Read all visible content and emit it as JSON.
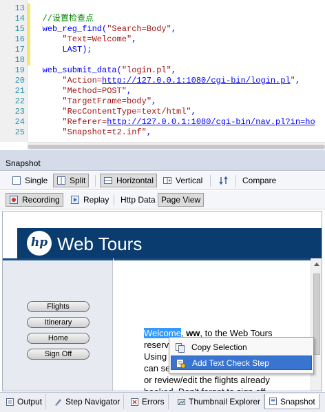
{
  "editor": {
    "lines": [
      {
        "num": "13",
        "text": ""
      },
      {
        "num": "14",
        "text": "        //设置检查点"
      },
      {
        "num": "15",
        "text": "        web_reg_find(\"Search=Body\","
      },
      {
        "num": "16",
        "text": "            \"Text=Welcome\","
      },
      {
        "num": "17",
        "text": "            LAST);"
      },
      {
        "num": "18",
        "text": ""
      },
      {
        "num": "19",
        "text": "        web_submit_data(\"login.pl\","
      },
      {
        "num": "20",
        "text": "            \"Action=http://127.0.0.1:1080/cgi-bin/login.pl\","
      },
      {
        "num": "21",
        "text": "            \"Method=POST\","
      },
      {
        "num": "22",
        "text": "            \"TargetFrame=body\","
      },
      {
        "num": "23",
        "text": "            \"RecContentType=text/html\","
      },
      {
        "num": "24",
        "text": "            \"Referer=http://127.0.0.1:1080/cgi-bin/nav.pl?in=ho"
      },
      {
        "num": "25",
        "text": "            \"Snapshot=t2.inf\","
      }
    ],
    "colors": {
      "comment": "#008000",
      "keyword": "#0000ff",
      "string": "#a31515",
      "url": "#0000ff",
      "lineNumber": "#2b91af",
      "modified": "#f5e86a"
    }
  },
  "pane": {
    "title": "Snapshot"
  },
  "toolbar1": {
    "single": "Single",
    "split": "Split",
    "horizontal": "Horizontal",
    "vertical": "Vertical",
    "compare": "Compare"
  },
  "toolbar2": {
    "recording": "Recording",
    "replay": "Replay",
    "http_data": "Http Data",
    "page_view": "Page View"
  },
  "webpage": {
    "logo_text": "hp",
    "title": "Web Tours",
    "nav": [
      "Flights",
      "Itinerary",
      "Home",
      "Sign Off"
    ],
    "welcome_word": "Welcome",
    "welcome_rest1": ", ",
    "user": "ww",
    "welcome_rest2": ", to the Web Tours",
    "line2": "reserv",
    "line3": "Using",
    "line4": "can se",
    "line5": "or review/edit the flights already",
    "line6": "booked. Don't forget to sign off"
  },
  "context_menu": {
    "items": [
      "Copy Selection",
      "Add Text Check Step"
    ],
    "selected_index": 1
  },
  "tabs": [
    "Output",
    "Step Navigator",
    "Errors",
    "Thumbnail Explorer",
    "Snapshot"
  ],
  "active_tab": "Snapshot"
}
